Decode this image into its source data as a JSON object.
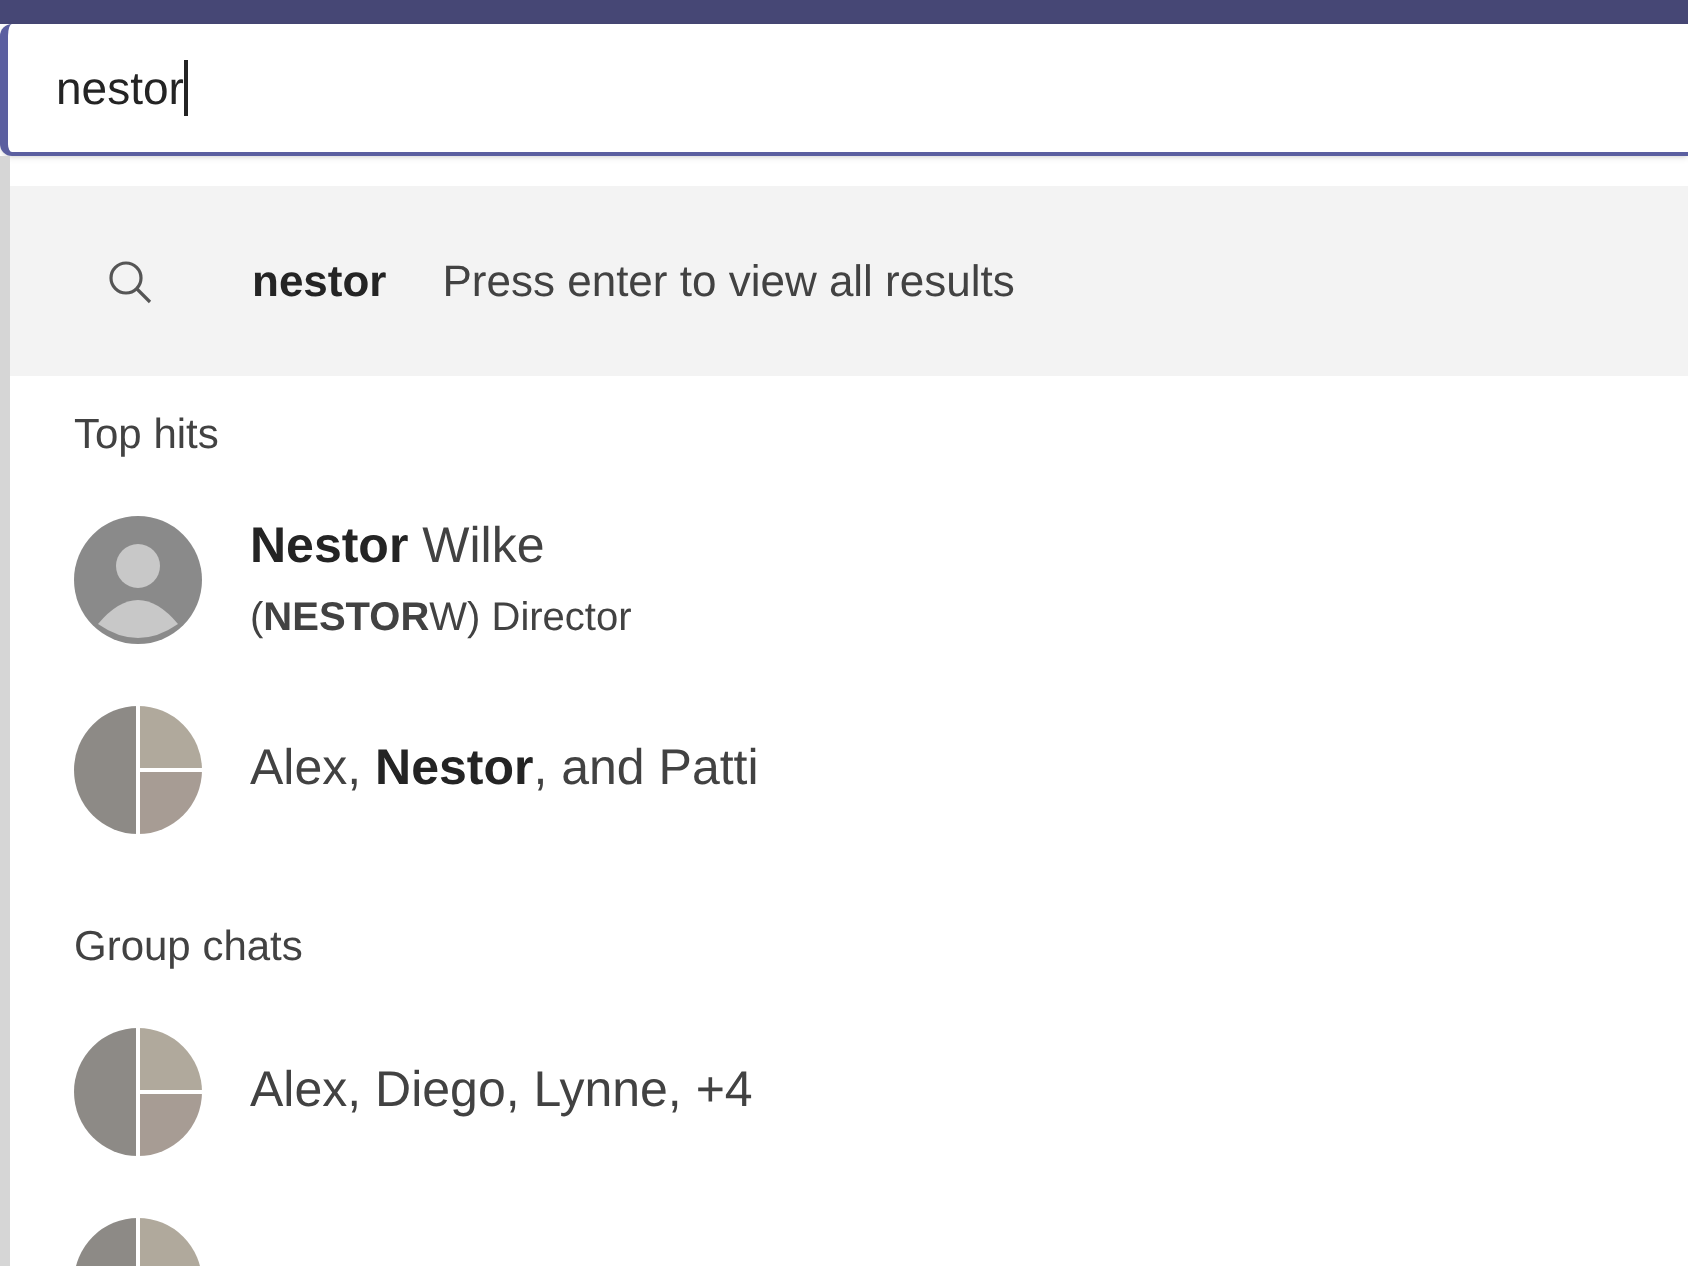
{
  "search": {
    "value": "nestor"
  },
  "suggestion": {
    "query": "nestor",
    "hint": "Press enter to view all results"
  },
  "sections": [
    {
      "title": "Top hits",
      "items": [
        {
          "kind": "person",
          "name": "**Nestor** Wilke",
          "detail": "(**NESTOR**W) Director"
        },
        {
          "kind": "group",
          "name": "Alex, **Nestor**, and Patti"
        }
      ]
    },
    {
      "title": "Group chats",
      "items": [
        {
          "kind": "group",
          "name": "Alex, Diego, Lynne, +4"
        },
        {
          "kind": "group"
        }
      ]
    }
  ]
}
